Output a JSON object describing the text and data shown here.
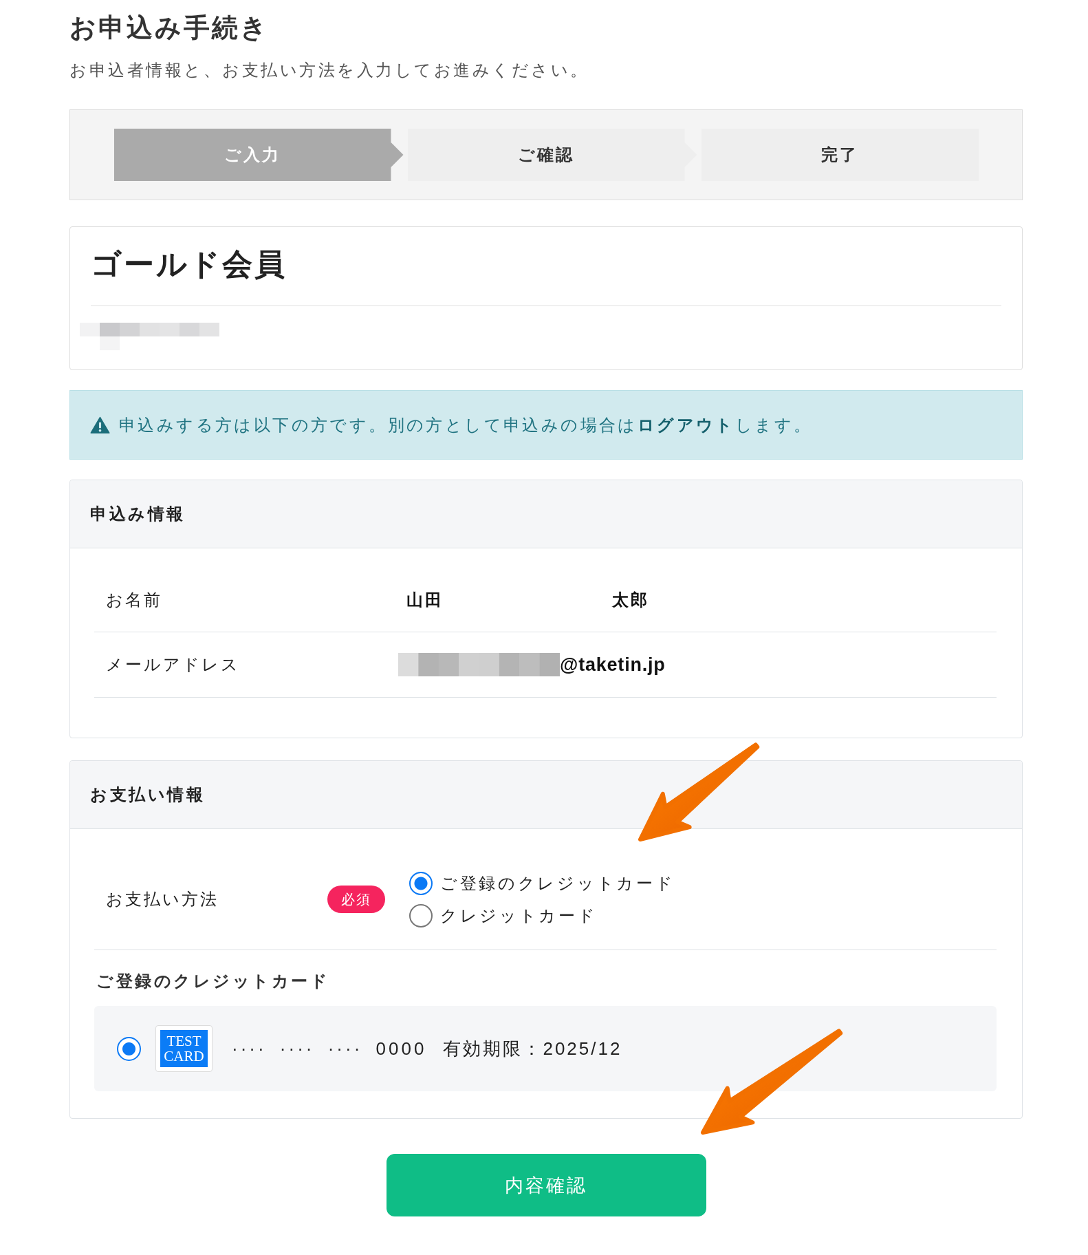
{
  "page": {
    "title": "お申込み手続き",
    "subtitle": "お申込者情報と、お支払い方法を入力してお進みください。"
  },
  "steps": [
    {
      "label": "ご入力",
      "selected": true
    },
    {
      "label": "ご確認",
      "selected": false
    },
    {
      "label": "完了",
      "selected": false
    }
  ],
  "plan": {
    "name": "ゴールド会員",
    "detail_redacted": true
  },
  "notice": {
    "kind": "warning",
    "text_before": "申込みする方は以下の方です。別の方として申込みの場合は",
    "link": "ログアウト",
    "text_after": "します。"
  },
  "application_info": {
    "title": "申込み情報",
    "rows": [
      {
        "kind": "name",
        "label": "お名前",
        "values": [
          "山田",
          "太郎"
        ]
      },
      {
        "kind": "email",
        "label": "メールアドレス",
        "value": "@taketin.jp",
        "local_part_redacted": true
      }
    ]
  },
  "payment_info": {
    "title": "お支払い情報",
    "method": {
      "label": "お支払い方法",
      "required_badge": "必須",
      "options": [
        {
          "label": "ご登録のクレジットカード",
          "selected": true
        },
        {
          "label": "クレジットカード",
          "selected": false
        }
      ]
    },
    "saved_cards": {
      "title": "ご登録のクレジットカード",
      "cards": [
        {
          "selected": true,
          "brand": "TEST CARD",
          "number": "···· ···· ···· 0000",
          "expiry": "有効期限：2025/12"
        }
      ]
    }
  },
  "submit_button": {
    "label": "内容確認"
  },
  "annotations": [
    {
      "kind": "arrow"
    },
    {
      "kind": "arrow"
    }
  ]
}
